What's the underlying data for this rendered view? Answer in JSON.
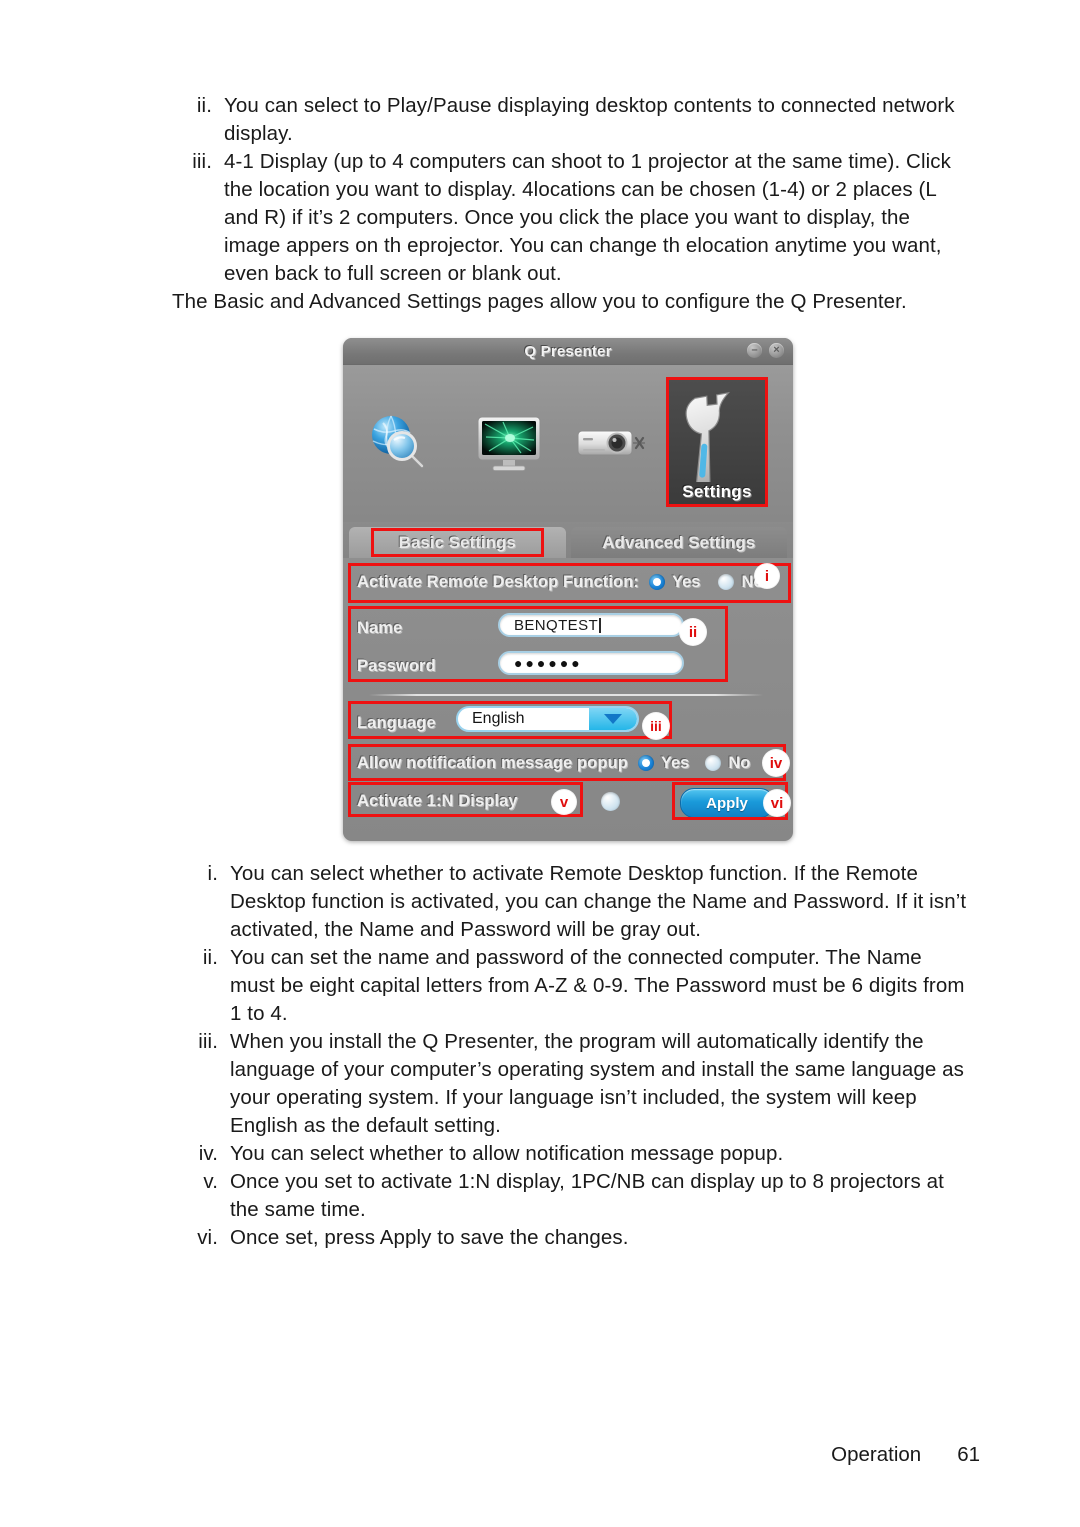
{
  "document": {
    "top_list": [
      {
        "marker": "ii.",
        "text": "You can select to Play/Pause displaying desktop contents to connected network display."
      },
      {
        "marker": "iii.",
        "text": "4-1 Display (up to 4 computers can shoot to 1 projector at the same time). Click the location you want to display. 4locations can be chosen (1-4) or 2 places (L and R) if it’s 2 computers. Once you click the place you want to display, the image appers on th eprojector. You can change th elocation anytime you want, even back to full screen or blank out."
      }
    ],
    "intro_paragraph": "The Basic and Advanced Settings pages allow you to configure the Q Presenter.",
    "bottom_list": [
      {
        "marker": "i.",
        "text": "You can select whether to activate Remote Desktop function. If the Remote Desktop function is activated, you can change the Name and  Password. If it isn’t activated, the Name and Password will be gray out."
      },
      {
        "marker": "ii.",
        "text": "You can set the name and password of the connected computer. The Name must be eight capital letters from A-Z & 0-9. The Password must be 6 digits from 1 to 4."
      },
      {
        "marker": "iii.",
        "text": " When you install the Q Presenter, the program will automatically identify the language of your computer’s operating system and install the same language as your operating system. If your language isn’t included, the system will keep English as the default setting."
      },
      {
        "marker": "iv.",
        "text": "You can select whether to allow notification message popup."
      },
      {
        "marker": "v.",
        "text": "Once you set to activate 1:N display, 1PC/NB can display up to 8 projectors at the same time."
      },
      {
        "marker": "vi.",
        "text": "Once set, press Apply to save the changes."
      }
    ]
  },
  "footer": {
    "section": "Operation",
    "page_number": "61"
  },
  "qpresenter": {
    "title": "Q Presenter",
    "window_buttons": {
      "minimize": "–",
      "close": "×"
    },
    "toolbar": {
      "icons": [
        {
          "name": "search-projector-icon",
          "label": ""
        },
        {
          "name": "display-desktop-icon",
          "label": ""
        },
        {
          "name": "projector-disconnect-icon",
          "label": ""
        },
        {
          "name": "settings-wrench-icon",
          "label": "Settings"
        }
      ],
      "settings_label": "Settings"
    },
    "tabs": [
      {
        "label": "Basic Settings",
        "active": true
      },
      {
        "label": "Advanced Settings",
        "active": false
      }
    ],
    "form": {
      "remote_desktop": {
        "label": "Activate Remote Desktop Function:",
        "yes_label": "Yes",
        "no_label": "No",
        "selected": "Yes"
      },
      "name": {
        "label": "Name",
        "value": "BENQTEST"
      },
      "password": {
        "label": "Password",
        "value": "●●●●●●"
      },
      "language": {
        "label": "Language",
        "value": "English"
      },
      "notification": {
        "label": "Allow notification message popup",
        "yes_label": "Yes",
        "no_label": "No",
        "selected": "Yes"
      },
      "one_to_n": {
        "label": "Activate 1:N Display",
        "checked": false
      },
      "apply": {
        "label": "Apply"
      }
    },
    "callouts": [
      {
        "id": "i",
        "target": "remote-desktop-row"
      },
      {
        "id": "ii",
        "target": "name-password-group"
      },
      {
        "id": "iii",
        "target": "language-row"
      },
      {
        "id": "iv",
        "target": "notification-row"
      },
      {
        "id": "v",
        "target": "one-to-n-row"
      },
      {
        "id": "vi",
        "target": "apply-button"
      }
    ],
    "highlight_color": "#ee1111"
  }
}
